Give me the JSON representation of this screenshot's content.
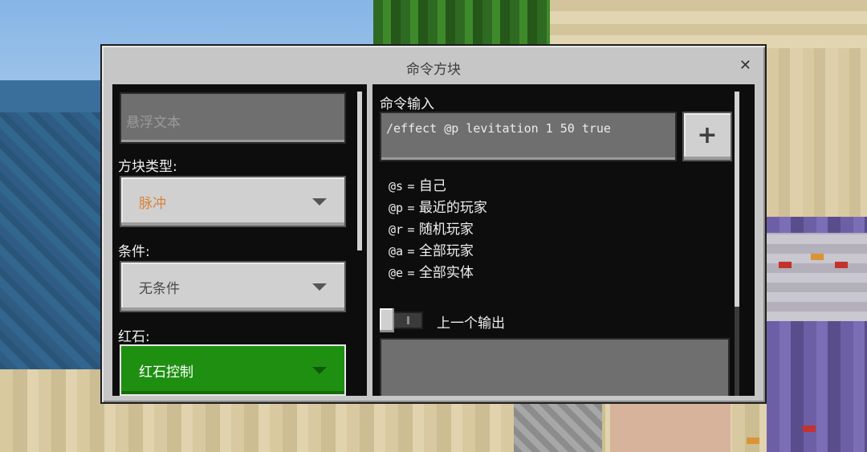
{
  "dialog": {
    "title": "命令方块",
    "close_icon": "close-icon"
  },
  "left_panel": {
    "hover_text_placeholder": "悬浮文本",
    "block_type_label": "方块类型:",
    "block_type_value": "脉冲",
    "condition_label": "条件:",
    "condition_value": "无条件",
    "redstone_label": "红石:",
    "redstone_value": "红石控制"
  },
  "right_panel": {
    "command_input_label": "命令输入",
    "command_value": "/effect @p levitation 1 50 true",
    "add_button_label": "+",
    "selectors": [
      {
        "code": "@s",
        "eq": "=",
        "desc": "自己"
      },
      {
        "code": "@p",
        "eq": "=",
        "desc": "最近的玩家"
      },
      {
        "code": "@r",
        "eq": "=",
        "desc": "随机玩家"
      },
      {
        "code": "@a",
        "eq": "=",
        "desc": "全部玩家"
      },
      {
        "code": "@e",
        "eq": "=",
        "desc": "全部实体"
      }
    ],
    "previous_output_label": "上一个输出",
    "previous_output_enabled": false
  },
  "colors": {
    "block_type_text": "#d9823b",
    "redstone_bg": "#1f8f12",
    "panel_bg": "#0d0d0d",
    "dialog_bg": "#c6c6c6"
  }
}
